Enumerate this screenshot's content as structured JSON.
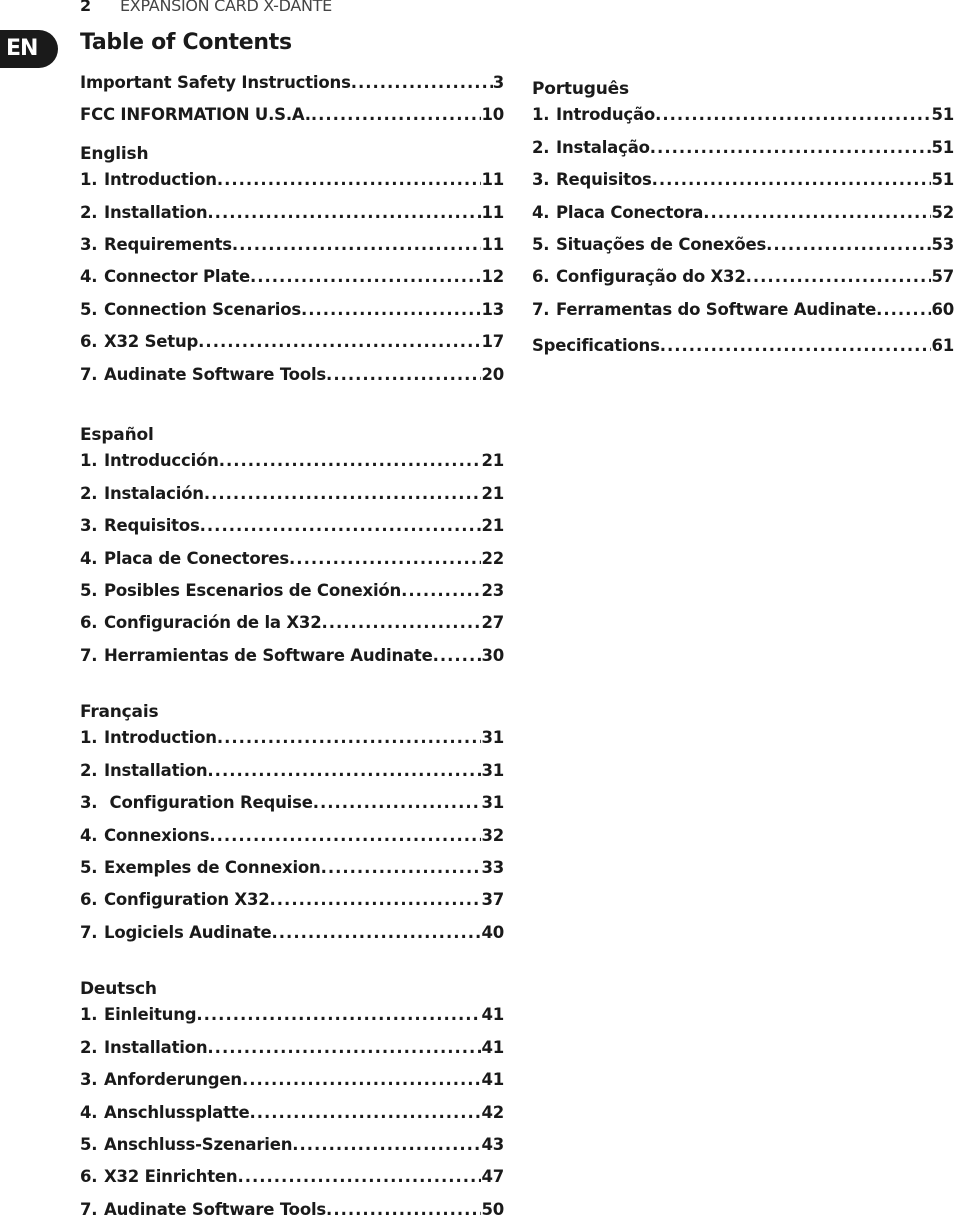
{
  "header": {
    "page_number": "2",
    "document_title": "EXPANSION CARD X-DANTE"
  },
  "language_badge": "EN",
  "title": "Table of Contents",
  "top_entries": [
    {
      "label": "Important Safety Instructions",
      "page": "3"
    },
    {
      "label": "FCC INFORMATION U.S.A. ",
      "page": "10"
    }
  ],
  "sections": {
    "english": {
      "heading": "English",
      "items": [
        {
          "num": "1.",
          "label": "Introduction",
          "page": "11"
        },
        {
          "num": "2.",
          "label": "Installation",
          "page": "11"
        },
        {
          "num": "3.",
          "label": "Requirements ",
          "page": "11"
        },
        {
          "num": "4.",
          "label": "Connector Plate",
          "page": "12"
        },
        {
          "num": "5.",
          "label": "Connection Scenarios",
          "page": "13"
        },
        {
          "num": "6.",
          "label": "X32 Setup ",
          "page": "17"
        },
        {
          "num": "7.",
          "label": "Audinate Software Tools ",
          "page": "20"
        }
      ]
    },
    "espanol": {
      "heading": "Español",
      "items": [
        {
          "num": "1.",
          "label": "Introducción ",
          "page": "21"
        },
        {
          "num": "2.",
          "label": "Instalación ",
          "page": "21"
        },
        {
          "num": "3.",
          "label": "Requisitos ",
          "page": "21"
        },
        {
          "num": "4.",
          "label": "Placa de Conectores",
          "page": "22"
        },
        {
          "num": "5.",
          "label": "Posibles Escenarios de Conexión ",
          "page": "23"
        },
        {
          "num": "6.",
          "label": "Configuración de la X32 ",
          "page": "27"
        },
        {
          "num": "7.",
          "label": "Herramientas de Software Audinate ",
          "page": "30"
        }
      ]
    },
    "francais": {
      "heading": "Français",
      "items": [
        {
          "num": "1.",
          "label": "Introduction",
          "page": "31"
        },
        {
          "num": "2.",
          "label": "Installation",
          "page": "31"
        },
        {
          "num": "3.",
          "label": " Configuration Requise  ",
          "page": "31"
        },
        {
          "num": "4.",
          "label": "Connexions ",
          "page": "32"
        },
        {
          "num": "5.",
          "label": "Exemples de Connexion ",
          "page": "33"
        },
        {
          "num": "6.",
          "label": "Configuration X32",
          "page": "37"
        },
        {
          "num": "7.",
          "label": "Logiciels Audinate",
          "page": " 40"
        }
      ]
    },
    "deutsch": {
      "heading": "Deutsch",
      "items": [
        {
          "num": "1.",
          "label": "Einleitung ",
          "page": "41"
        },
        {
          "num": "2.",
          "label": "Installation",
          "page": "41"
        },
        {
          "num": "3.",
          "label": "Anforderungen ",
          "page": "41"
        },
        {
          "num": "4.",
          "label": "Anschlussplatte",
          "page": "42"
        },
        {
          "num": "5.",
          "label": "Anschluss-Szenarien",
          "page": "43"
        },
        {
          "num": "6.",
          "label": "X32 Einrichten ",
          "page": "47"
        },
        {
          "num": "7.",
          "label": "Audinate Software Tools ",
          "page": "50"
        }
      ]
    },
    "portugues": {
      "heading": "Português",
      "items": [
        {
          "num": "1.",
          "label": "Introdução",
          "page": "51"
        },
        {
          "num": "2.",
          "label": "Instalação",
          "page": "51"
        },
        {
          "num": "3.",
          "label": "Requisitos ",
          "page": "51"
        },
        {
          "num": "4.",
          "label": "Placa Conectora",
          "page": "52"
        },
        {
          "num": "5.",
          "label": "Situações de Conexões",
          "page": "53"
        },
        {
          "num": "6.",
          "label": "Configuração do X32 ",
          "page": "57"
        },
        {
          "num": "7.",
          "label": "Ferramentas do Software Audinate  ",
          "page": " 60"
        }
      ]
    }
  },
  "specifications": {
    "label": "Specifications ",
    "page": "61"
  }
}
